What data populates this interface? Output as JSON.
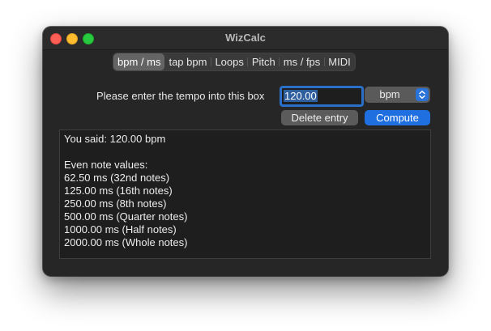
{
  "window": {
    "title": "WizCalc"
  },
  "tabs": [
    {
      "label": "bpm / ms",
      "active": true
    },
    {
      "label": "tap bpm",
      "active": false
    },
    {
      "label": "Loops",
      "active": false
    },
    {
      "label": "Pitch",
      "active": false
    },
    {
      "label": "ms / fps",
      "active": false
    },
    {
      "label": "MIDI",
      "active": false
    }
  ],
  "form": {
    "prompt": "Please enter the tempo into this box",
    "tempo_value": "120.00",
    "unit_selected": "bpm",
    "delete_label": "Delete entry",
    "compute_label": "Compute"
  },
  "output": {
    "said": "You said: 120.00 bpm",
    "heading": "Even note values:",
    "lines": [
      "62.50 ms (32nd notes)",
      "125.00 ms (16th notes)",
      "250.00 ms (8th notes)",
      "500.00 ms (Quarter notes)",
      "1000.00 ms (Half notes)",
      "2000.00 ms (Whole notes)"
    ]
  },
  "colors": {
    "accent": "#1f6fe0",
    "focus_ring": "#2a6fc8",
    "window_bg": "#262626"
  },
  "icons": {
    "select_chevron": "chevron-up-down-icon"
  }
}
